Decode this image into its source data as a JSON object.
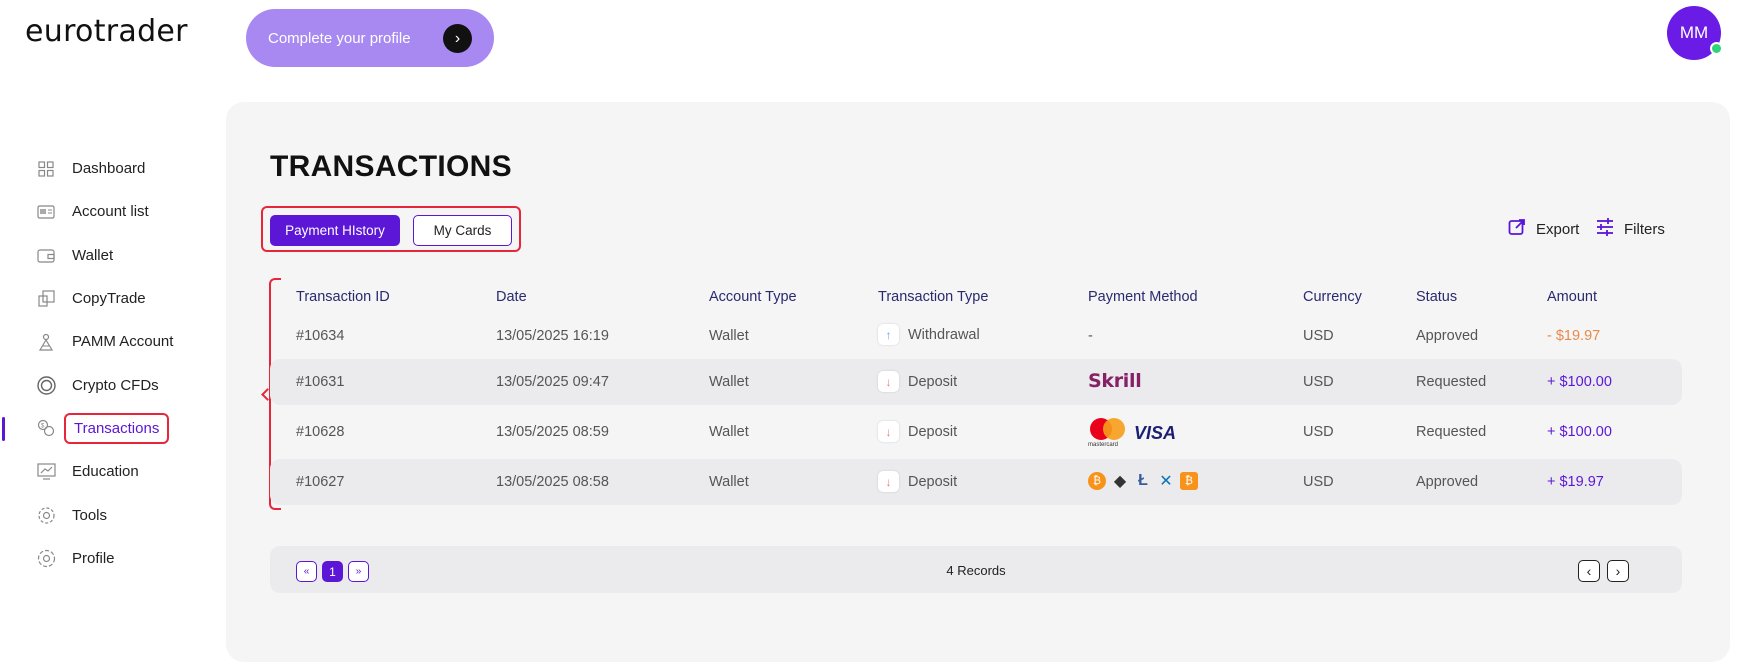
{
  "brand": {
    "logo": "eurotrader"
  },
  "header": {
    "profile_cta": "Complete your profile",
    "profile_cta_icon": "chevron-right-icon",
    "avatar_initials": "MM"
  },
  "sidebar": {
    "items": [
      {
        "label": "Dashboard",
        "icon": "grid-icon"
      },
      {
        "label": "Account list",
        "icon": "account-card-icon"
      },
      {
        "label": "Wallet",
        "icon": "wallet-icon"
      },
      {
        "label": "CopyTrade",
        "icon": "copy-icon"
      },
      {
        "label": "PAMM Account",
        "icon": "pamm-icon"
      },
      {
        "label": "Crypto CFDs",
        "icon": "crypto-coin-icon"
      },
      {
        "label": "Transactions",
        "icon": "transactions-icon",
        "active": true
      },
      {
        "label": "Education",
        "icon": "education-icon"
      },
      {
        "label": "Tools",
        "icon": "gear-icon"
      },
      {
        "label": "Profile",
        "icon": "profile-gear-icon"
      }
    ]
  },
  "main": {
    "title": "TRANSACTIONS",
    "tabs": [
      {
        "label": "Payment HIstory",
        "active": true
      },
      {
        "label": "My Cards",
        "active": false
      }
    ],
    "actions": {
      "export": "Export",
      "filters": "Filters"
    },
    "table": {
      "columns": [
        "Transaction ID",
        "Date",
        "Account Type",
        "Transaction Type",
        "Payment Method",
        "Currency",
        "Status",
        "Amount"
      ],
      "rows": [
        {
          "id": "#10634",
          "date": "13/05/2025 16:19",
          "account": "Wallet",
          "type": "Withdrawal",
          "direction": "up",
          "method": "-",
          "method_kind": "none",
          "currency": "USD",
          "status": "Approved",
          "amount": "- $19.97",
          "sign": "neg"
        },
        {
          "id": "#10631",
          "date": "13/05/2025 09:47",
          "account": "Wallet",
          "type": "Deposit",
          "direction": "down",
          "method": "Skrill",
          "method_kind": "skrill",
          "currency": "USD",
          "status": "Requested",
          "amount": "+ $100.00",
          "sign": "pos"
        },
        {
          "id": "#10628",
          "date": "13/05/2025 08:59",
          "account": "Wallet",
          "type": "Deposit",
          "direction": "down",
          "method": "VISA",
          "method_kind": "card",
          "currency": "USD",
          "status": "Requested",
          "amount": "+ $100.00",
          "sign": "pos"
        },
        {
          "id": "#10627",
          "date": "13/05/2025 08:58",
          "account": "Wallet",
          "type": "Deposit",
          "direction": "down",
          "method": "",
          "method_kind": "crypto",
          "currency": "USD",
          "status": "Approved",
          "amount": "+ $19.97",
          "sign": "pos"
        }
      ]
    },
    "pagination": {
      "first": "«",
      "current": "1",
      "last": "»",
      "records": "4 Records",
      "prev": "‹",
      "next": "›"
    }
  },
  "colors": {
    "accent": "#5b16d6",
    "highlight": "#e8263a",
    "online": "#2ed47a",
    "negative": "#e88a4a"
  }
}
